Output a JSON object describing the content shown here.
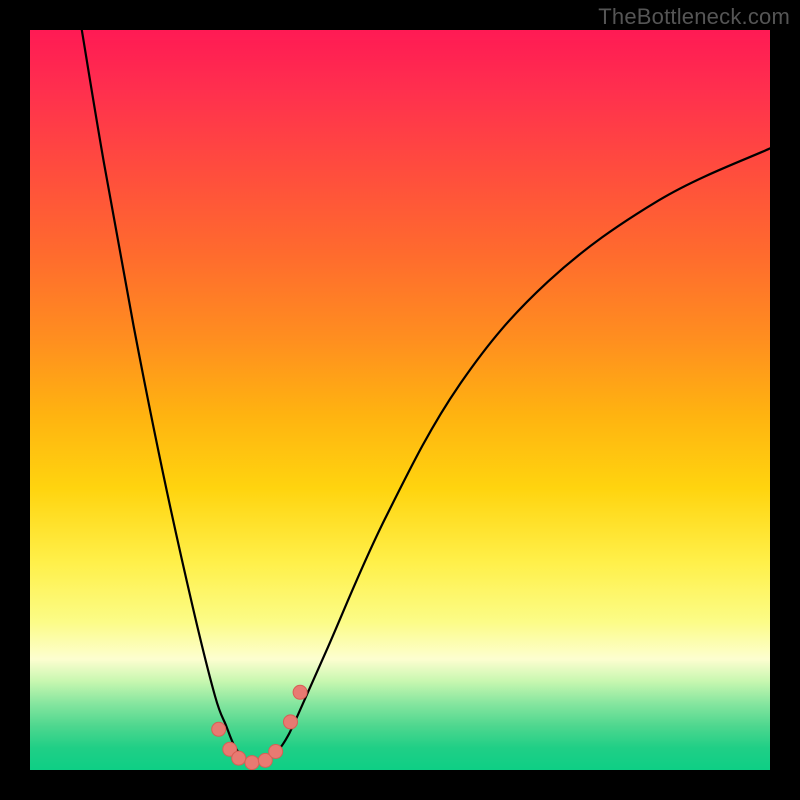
{
  "watermark": "TheBottleneck.com",
  "chart_data": {
    "type": "line",
    "title": "",
    "xlabel": "",
    "ylabel": "",
    "xlim": [
      0,
      100
    ],
    "ylim": [
      0,
      100
    ],
    "grid": false,
    "series": [
      {
        "name": "left-branch",
        "x": [
          7,
          10,
          14,
          18,
          22,
          25,
          26.5,
          27.5,
          28.5,
          29.5
        ],
        "y": [
          100,
          82,
          60,
          40,
          22,
          10,
          6,
          3.5,
          2,
          1.2
        ]
      },
      {
        "name": "right-branch",
        "x": [
          32,
          33,
          34.5,
          36,
          40,
          48,
          58,
          70,
          85,
          100
        ],
        "y": [
          1.2,
          2,
          4,
          7,
          16,
          34,
          52,
          66,
          77,
          84
        ]
      }
    ],
    "markers": [
      {
        "x": 25.5,
        "y": 5.5
      },
      {
        "x": 27.0,
        "y": 2.8
      },
      {
        "x": 28.2,
        "y": 1.6
      },
      {
        "x": 30.0,
        "y": 1.0
      },
      {
        "x": 31.8,
        "y": 1.3
      },
      {
        "x": 33.2,
        "y": 2.5
      },
      {
        "x": 35.2,
        "y": 6.5
      },
      {
        "x": 36.5,
        "y": 10.5
      }
    ],
    "colors": {
      "curve": "#000000",
      "marker_fill": "#e87a72",
      "marker_stroke": "#d85f55",
      "gradient_top": "#ff1a54",
      "gradient_bottom": "#0ecf85"
    }
  }
}
